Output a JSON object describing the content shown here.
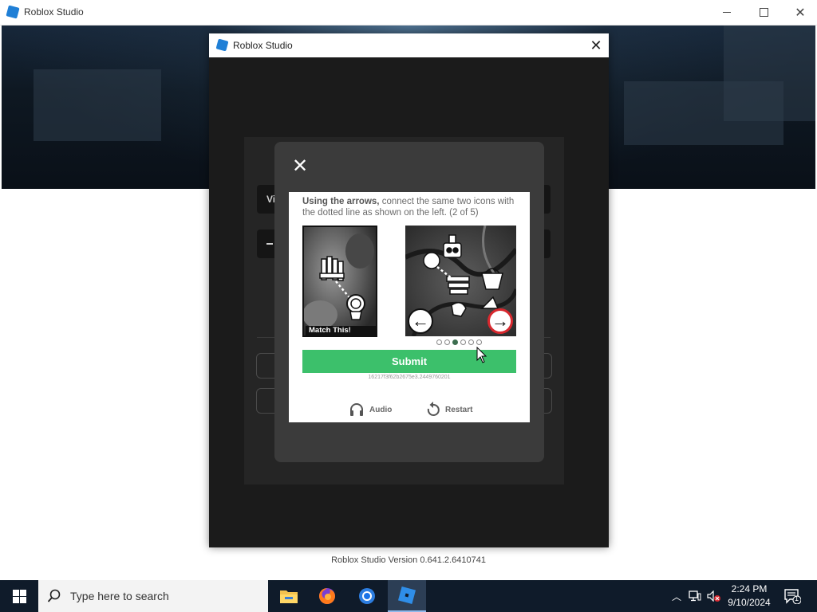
{
  "app_window": {
    "title": "Roblox Studio",
    "version_text": "Roblox Studio Version 0.641.2.6410741"
  },
  "dialog": {
    "title": "Roblox Studio",
    "close_glyph": "✕"
  },
  "login_panel": {
    "partial_label": "Vi"
  },
  "captcha": {
    "close_glyph": "✕",
    "instruction_bold": "Using the arrows,",
    "instruction_rest": " connect the same two icons with the dotted line as shown on the left. (2 of 5)",
    "example_label": "Match This!",
    "submit_label": "Submit",
    "session_id": "16217f3f62b2675e3.2449760201",
    "audio_label": "Audio",
    "restart_label": "Restart",
    "pagination": {
      "total": 6,
      "active": 2
    },
    "arrow_left_glyph": "←",
    "arrow_right_glyph": "→",
    "colors": {
      "submit": "#3cc06b",
      "active_dot": "#3c6e4f",
      "right_arrow_ring": "#d8282e"
    }
  },
  "taskbar": {
    "search_placeholder": "Type here to search",
    "pinned_apps": [
      "file-explorer-icon",
      "firefox-icon",
      "chrome-icon",
      "roblox-studio-icon"
    ],
    "active_app": "roblox-studio-icon",
    "clock_time": "2:24 PM",
    "clock_date": "9/10/2024",
    "notification_count": "1"
  }
}
